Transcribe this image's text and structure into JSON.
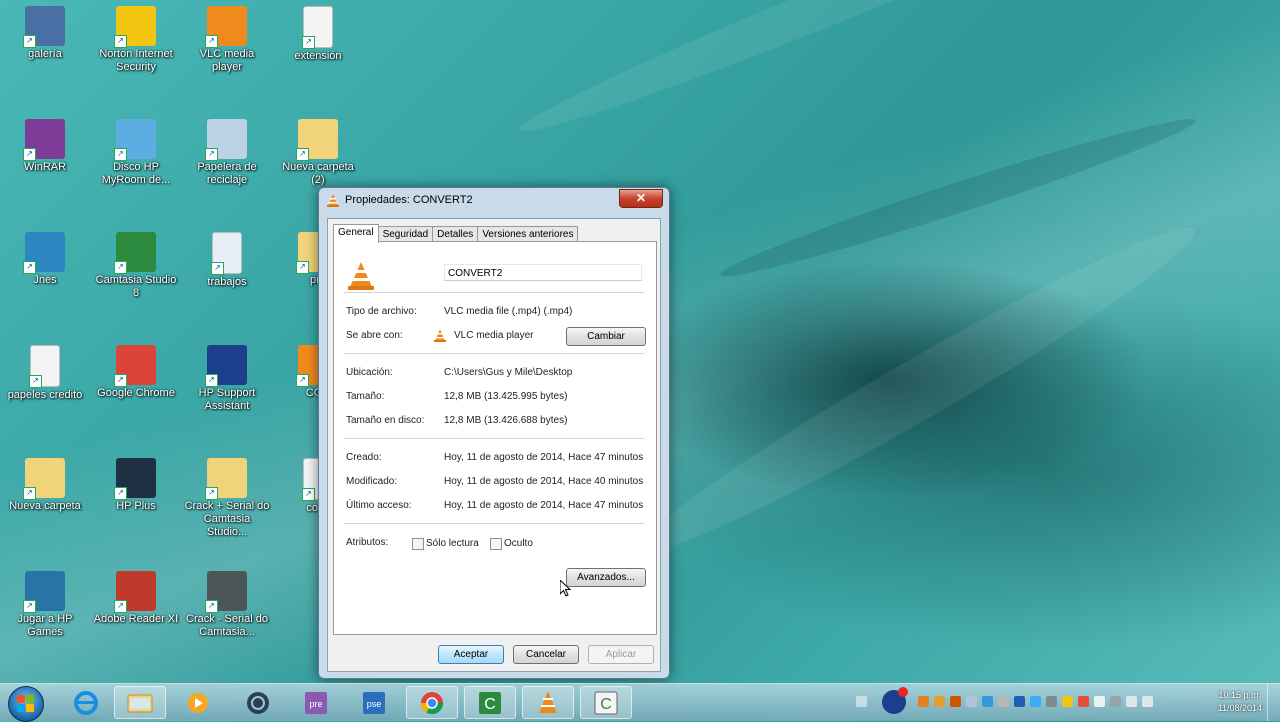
{
  "desktop": {
    "icons": [
      {
        "label": "galería",
        "icon": "gallery-icon"
      },
      {
        "label": "Norton Internet Security",
        "icon": "norton-icon"
      },
      {
        "label": "VLC media player",
        "icon": "vlc-icon"
      },
      {
        "label": "extensión",
        "icon": "document-icon"
      },
      {
        "label": "WinRAR",
        "icon": "winrar-icon"
      },
      {
        "label": "Disco HP MyRoom de...",
        "icon": "hp-myroom-icon"
      },
      {
        "label": "Papelera de reciclaje",
        "icon": "recycle-bin-icon"
      },
      {
        "label": "Nueva carpeta (2)",
        "icon": "folder-icon"
      },
      {
        "label": "Jnes",
        "icon": "jnes-icon"
      },
      {
        "label": "Camtasia Studio 8",
        "icon": "camtasia-icon"
      },
      {
        "label": "trabajos",
        "icon": "word-doc-icon"
      },
      {
        "label": "pro",
        "icon": "folder-icon"
      },
      {
        "label": "papeles credito",
        "icon": "document-icon"
      },
      {
        "label": "Google Chrome",
        "icon": "chrome-icon"
      },
      {
        "label": "HP Support Assistant",
        "icon": "help-icon"
      },
      {
        "label": "CON",
        "icon": "vlc-file-icon"
      },
      {
        "label": "Nueva carpeta",
        "icon": "folder-icon"
      },
      {
        "label": "HP Plus",
        "icon": "hp-icon"
      },
      {
        "label": "Crack + Serial do Camtasia Studio...",
        "icon": "folder-icon"
      },
      {
        "label": "conv",
        "icon": "document-icon"
      },
      {
        "label": "Jugar a HP Games",
        "icon": "hp-games-icon"
      },
      {
        "label": "Adobe Reader XI",
        "icon": "adobe-reader-icon"
      },
      {
        "label": "Crack - Serial do Camtasia...",
        "icon": "archive-icon"
      }
    ]
  },
  "window": {
    "title": "Propiedades: CONVERT2",
    "close_label": "✕",
    "tabs": [
      {
        "label": "General",
        "active": true
      },
      {
        "label": "Seguridad",
        "active": false
      },
      {
        "label": "Detalles",
        "active": false
      },
      {
        "label": "Versiones anteriores",
        "active": false
      }
    ],
    "file_name": "CONVERT2",
    "type_label": "Tipo de archivo:",
    "type_value": "VLC media file (.mp4) (.mp4)",
    "opens_label": "Se abre con:",
    "opens_value": "VLC media player",
    "change_button": "Cambiar",
    "location_label": "Ubicación:",
    "location_value": "C:\\Users\\Gus y Mile\\Desktop",
    "size_label": "Tamaño:",
    "size_value": "12,8 MB (13.425.995 bytes)",
    "disk_size_label": "Tamaño en disco:",
    "disk_size_value": "12,8 MB (13.426.688 bytes)",
    "created_label": "Creado:",
    "created_value": "Hoy, 11 de agosto de 2014, Hace 47 minutos",
    "modified_label": "Modificado:",
    "modified_value": "Hoy, 11 de agosto de 2014, Hace 40 minutos",
    "accessed_label": "Último acceso:",
    "accessed_value": "Hoy, 11 de agosto de 2014, Hace 47 minutos",
    "attributes_label": "Atributos:",
    "readonly_label": "Sólo lectura",
    "hidden_label": "Oculto",
    "advanced_button": "Avanzados...",
    "ok_button": "Aceptar",
    "cancel_button": "Cancelar",
    "apply_button": "Aplicar"
  },
  "taskbar": {
    "items": [
      "start-button",
      "internet-explorer-icon",
      "file-explorer-icon",
      "media-player-icon",
      "network-icon",
      "premiere-icon",
      "photoshop-elements-icon",
      "chrome-icon",
      "camtasia-icon",
      "vlc-icon",
      "camtasia-recorder-icon"
    ],
    "clock_time": "10:15 p.m.",
    "clock_date": "11/08/2014",
    "colors": {
      "accent": "#3c7fb1"
    }
  }
}
